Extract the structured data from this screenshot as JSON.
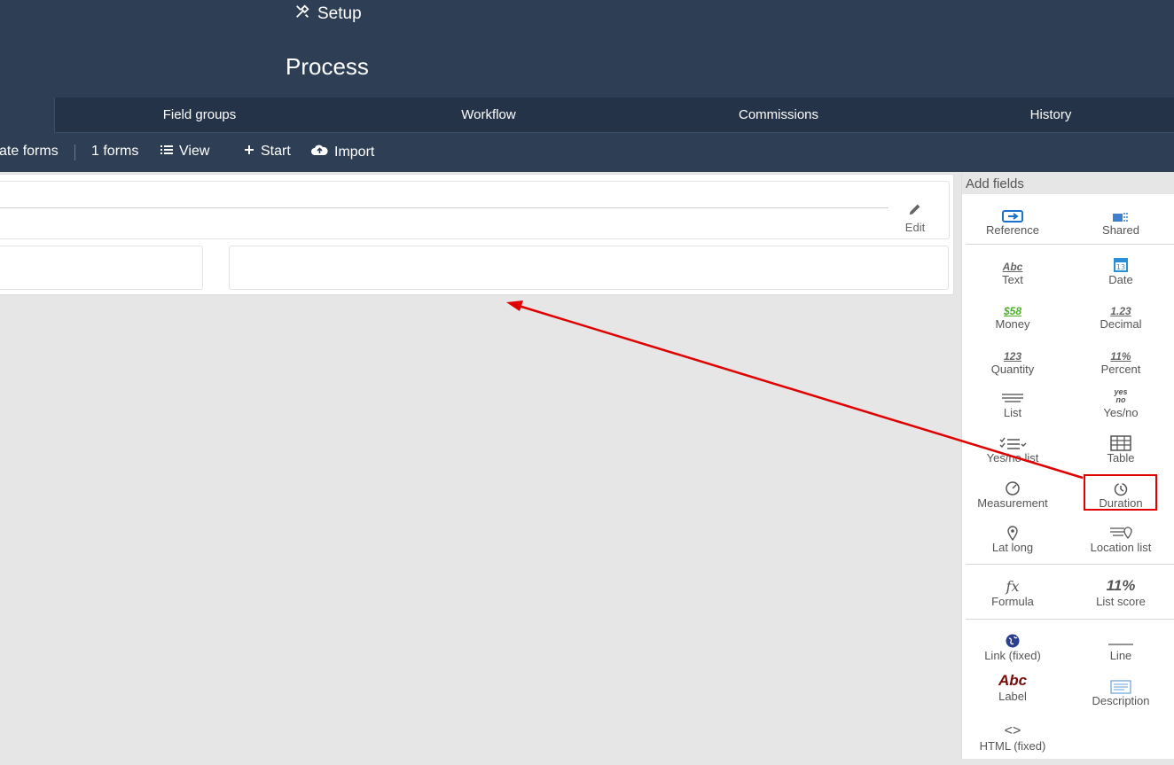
{
  "header": {
    "setup_label": "Setup",
    "title": "Process"
  },
  "tabs": [
    {
      "label": ""
    },
    {
      "label": "Field groups"
    },
    {
      "label": "Workflow"
    },
    {
      "label": "Commissions"
    },
    {
      "label": "History"
    }
  ],
  "toolbar": {
    "forms_partial": "ate forms",
    "forms_count": "1 forms",
    "view": "View",
    "start": "Start",
    "import": "Import"
  },
  "form": {
    "edit_label": "Edit"
  },
  "add_fields": {
    "header": "Add fields",
    "fields": {
      "reference": "Reference",
      "shared": "Shared",
      "text": "Text",
      "date": "Date",
      "money": "Money",
      "decimal": "Decimal",
      "quantity": "Quantity",
      "percent": "Percent",
      "list": "List",
      "yes_no": "Yes/no",
      "yes_no_list": "Yes/no list",
      "table": "Table",
      "measurement": "Measurement",
      "duration": "Duration",
      "lat_long": "Lat long",
      "location_list": "Location list",
      "formula": "Formula",
      "list_score": "List score",
      "link_fixed": "Link (fixed)",
      "line": "Line",
      "label": "Label",
      "description": "Description",
      "html_fixed": "HTML (fixed)"
    },
    "icon_text": {
      "text": "Abc",
      "money": "$58",
      "decimal": "1.23",
      "quantity": "123",
      "percent": "11%",
      "yes": "yes",
      "no": "no",
      "date_month": "JUN",
      "date_day": "13",
      "formula": "fx",
      "list_score": "11%",
      "label": "Abc",
      "html": "<>"
    }
  },
  "colors": {
    "header_bg": "#2e3e54",
    "tab_bg": "#243347",
    "highlight": "#e00000",
    "money": "#4caf27",
    "label": "#7a0b0b",
    "reference": "#1a73c9"
  }
}
